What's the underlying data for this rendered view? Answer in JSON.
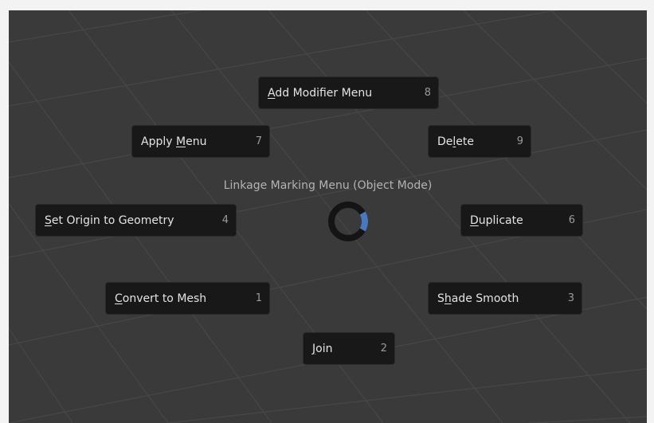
{
  "pie_menu": {
    "title": "Linkage Marking Menu (Object Mode)",
    "items": [
      {
        "id": "add-modifier-menu",
        "pre": "",
        "mn": "A",
        "post": "dd Modifier Menu",
        "key": "8"
      },
      {
        "id": "apply-menu",
        "pre": "Apply ",
        "mn": "M",
        "post": "enu",
        "key": "7"
      },
      {
        "id": "delete",
        "pre": "De",
        "mn": "l",
        "post": "ete",
        "key": "9"
      },
      {
        "id": "set-origin-to-geometry",
        "pre": "",
        "mn": "S",
        "post": "et Origin to Geometry",
        "key": "4"
      },
      {
        "id": "duplicate",
        "pre": "",
        "mn": "D",
        "post": "uplicate",
        "key": "6"
      },
      {
        "id": "convert-to-mesh",
        "pre": "",
        "mn": "C",
        "post": "onvert to Mesh",
        "key": "1"
      },
      {
        "id": "shade-smooth",
        "pre": "S",
        "mn": "h",
        "post": "ade Smooth",
        "key": "3"
      },
      {
        "id": "join",
        "pre": "",
        "mn": "J",
        "post": "oin",
        "key": "2"
      }
    ],
    "accent_color": "#4a78c0",
    "ring_color": "#141414"
  }
}
